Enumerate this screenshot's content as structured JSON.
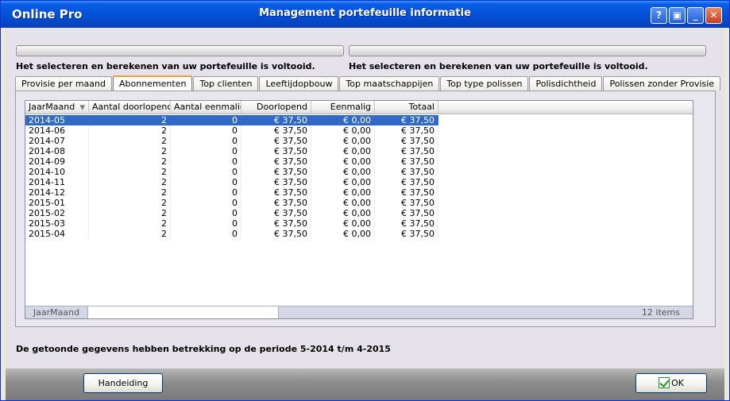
{
  "window": {
    "app_name": "Online Pro",
    "title": "Management portefeuille informatie",
    "buttons": {
      "help": "?",
      "restore": "▣",
      "minimize": "_",
      "close": "✕"
    }
  },
  "progress": [
    {
      "value_percent": 100,
      "status": "Het selecteren en berekenen van uw portefeuille is voltooid."
    },
    {
      "value_percent": 100,
      "status": "Het selecteren en berekenen van uw portefeuille is voltooid."
    }
  ],
  "tabs": [
    {
      "label": "Provisie per maand",
      "active": false
    },
    {
      "label": "Abonnementen",
      "active": true
    },
    {
      "label": "Top clienten",
      "active": false
    },
    {
      "label": "Leeftijdopbouw",
      "active": false
    },
    {
      "label": "Top maatschappijen",
      "active": false
    },
    {
      "label": "Top type polissen",
      "active": false
    },
    {
      "label": "Polisdichtheid",
      "active": false
    },
    {
      "label": "Polissen zonder Provisie",
      "active": false
    }
  ],
  "grid": {
    "columns": [
      "JaarMaand",
      "Aantal doorlopend",
      "Aantal eenmalig",
      "Doorlopend",
      "Eenmalig",
      "Totaal"
    ],
    "sort_icon": "sort-descending-icon",
    "rows": [
      [
        "2014-05",
        "2",
        "0",
        "€ 37,50",
        "€ 0,00",
        "€ 37,50"
      ],
      [
        "2014-06",
        "2",
        "0",
        "€ 37,50",
        "€ 0,00",
        "€ 37,50"
      ],
      [
        "2014-07",
        "2",
        "0",
        "€ 37,50",
        "€ 0,00",
        "€ 37,50"
      ],
      [
        "2014-08",
        "2",
        "0",
        "€ 37,50",
        "€ 0,00",
        "€ 37,50"
      ],
      [
        "2014-09",
        "2",
        "0",
        "€ 37,50",
        "€ 0,00",
        "€ 37,50"
      ],
      [
        "2014-10",
        "2",
        "0",
        "€ 37,50",
        "€ 0,00",
        "€ 37,50"
      ],
      [
        "2014-11",
        "2",
        "0",
        "€ 37,50",
        "€ 0,00",
        "€ 37,50"
      ],
      [
        "2014-12",
        "2",
        "0",
        "€ 37,50",
        "€ 0,00",
        "€ 37,50"
      ],
      [
        "2015-01",
        "2",
        "0",
        "€ 37,50",
        "€ 0,00",
        "€ 37,50"
      ],
      [
        "2015-02",
        "2",
        "0",
        "€ 37,50",
        "€ 0,00",
        "€ 37,50"
      ],
      [
        "2015-03",
        "2",
        "0",
        "€ 37,50",
        "€ 0,00",
        "€ 37,50"
      ],
      [
        "2015-04",
        "2",
        "0",
        "€ 37,50",
        "€ 0,00",
        "€ 37,50"
      ]
    ],
    "selected_row": 0,
    "footer": {
      "label": "JaarMaand",
      "filter_value": "",
      "count": "12 items"
    }
  },
  "period_text": "De getoonde gegevens hebben betrekking op de periode 5-2014 t/m 4-2015",
  "buttons": {
    "manual": "Handeiding",
    "ok": "OK"
  },
  "colors": {
    "titlebar": "#0553D8",
    "selection": "#3169C6",
    "client_bg": "#E5E2EC",
    "active_tab_accent": "#E8A23B"
  }
}
